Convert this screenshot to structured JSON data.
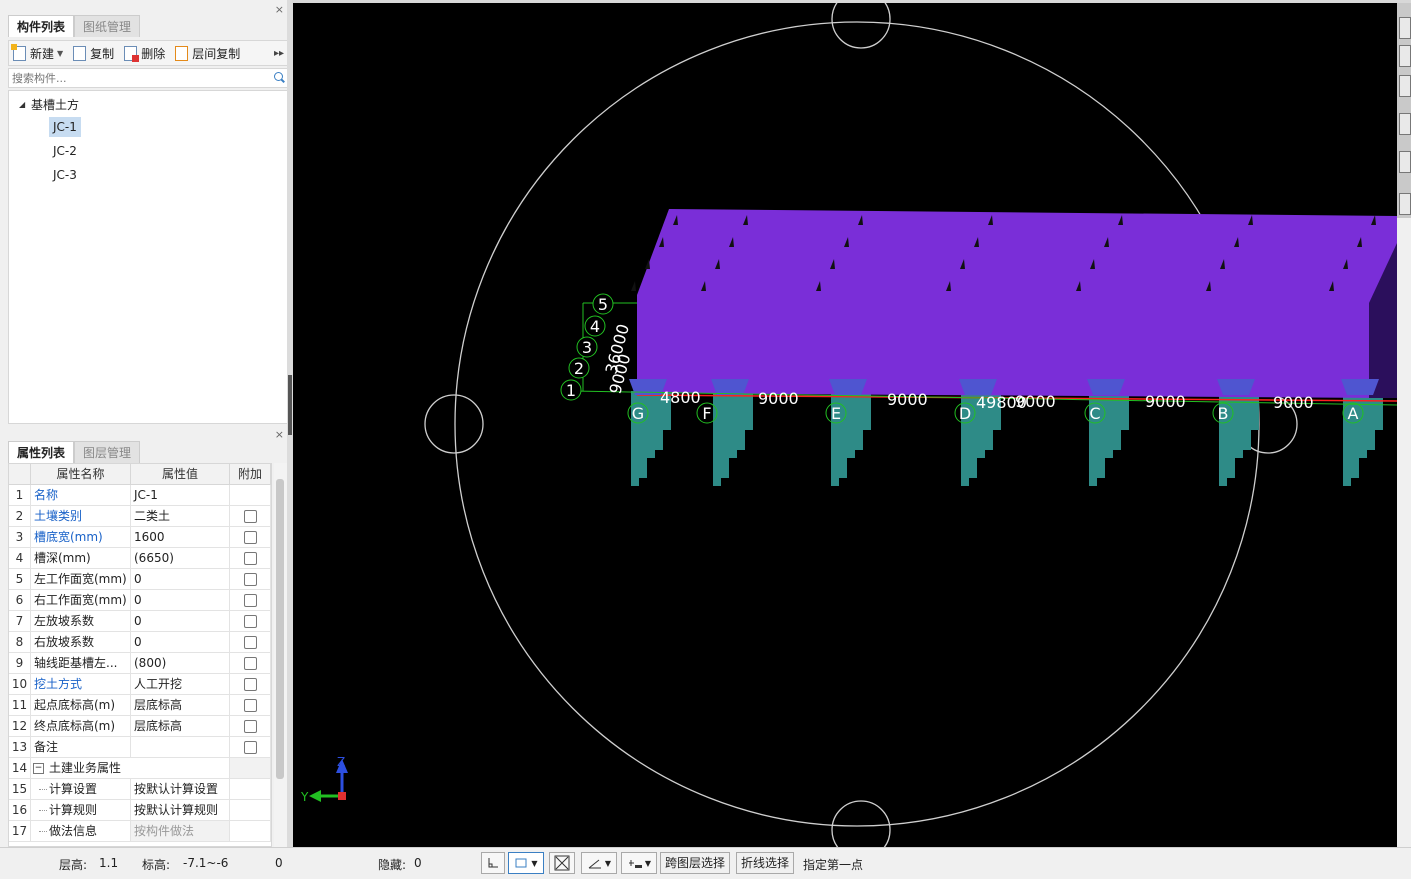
{
  "component_panel": {
    "tabs": [
      "构件列表",
      "图纸管理"
    ],
    "close": "×",
    "toolbar": {
      "new": "新建",
      "copy": "复制",
      "delete": "删除",
      "floor_copy": "层间复制",
      "more": "▸▸"
    },
    "search_placeholder": "搜索构件...",
    "tree": {
      "root": "基槽土方",
      "items": [
        "JC-1",
        "JC-2",
        "JC-3"
      ],
      "selected": "JC-1"
    }
  },
  "property_panel": {
    "tabs": [
      "属性列表",
      "图层管理"
    ],
    "close": "×",
    "headers": {
      "no": "",
      "name": "属性名称",
      "value": "属性值",
      "add": "附加"
    },
    "rows": [
      {
        "no": "1",
        "name": "名称",
        "value": "JC-1",
        "blue": true,
        "checkbox": false
      },
      {
        "no": "2",
        "name": "土壤类别",
        "value": "二类土",
        "blue": true,
        "checkbox": true
      },
      {
        "no": "3",
        "name": "槽底宽(mm)",
        "value": "1600",
        "blue": true,
        "checkbox": true
      },
      {
        "no": "4",
        "name": "槽深(mm)",
        "value": "(6650)",
        "blue": false,
        "checkbox": true
      },
      {
        "no": "5",
        "name": "左工作面宽(mm)",
        "value": "0",
        "blue": false,
        "checkbox": true
      },
      {
        "no": "6",
        "name": "右工作面宽(mm)",
        "value": "0",
        "blue": false,
        "checkbox": true
      },
      {
        "no": "7",
        "name": "左放坡系数",
        "value": "0",
        "blue": false,
        "checkbox": true
      },
      {
        "no": "8",
        "name": "右放坡系数",
        "value": "0",
        "blue": false,
        "checkbox": true
      },
      {
        "no": "9",
        "name": "轴线距基槽左...",
        "value": "(800)",
        "blue": false,
        "checkbox": true
      },
      {
        "no": "10",
        "name": "挖土方式",
        "value": "人工开挖",
        "blue": true,
        "checkbox": true
      },
      {
        "no": "11",
        "name": "起点底标高(m)",
        "value": "层底标高",
        "blue": false,
        "checkbox": true
      },
      {
        "no": "12",
        "name": "终点底标高(m)",
        "value": "层底标高",
        "blue": false,
        "checkbox": true
      },
      {
        "no": "13",
        "name": "备注",
        "value": "",
        "blue": false,
        "checkbox": true
      }
    ],
    "group": {
      "no": "14",
      "toggle": "−",
      "name": "土建业务属性"
    },
    "sub_rows": [
      {
        "no": "15",
        "name": "计算设置",
        "value": "按默认计算设置",
        "gray": false
      },
      {
        "no": "16",
        "name": "计算规则",
        "value": "按默认计算规则",
        "gray": false
      },
      {
        "no": "17",
        "name": "做法信息",
        "value": "按构件做法",
        "gray": true
      }
    ]
  },
  "viewport": {
    "axis_labels": {
      "z": "Z",
      "y": "Y"
    },
    "grid_letters": [
      "G",
      "F",
      "E",
      "D",
      "C",
      "B",
      "A"
    ],
    "grid_numbers": [
      "1",
      "2",
      "3",
      "4",
      "5"
    ],
    "dimensions": [
      "4800",
      "9000",
      "9000",
      "49800",
      "9000",
      "9000",
      "9000"
    ],
    "side_dims": [
      "36000",
      "9000"
    ],
    "colors": {
      "slab": "#7a2ed8",
      "piles": "#2e8b87",
      "caps": "#4f55d0",
      "grid": "#22c022",
      "circle": "#cfcfcf"
    }
  },
  "status": {
    "floor_height_label": "层高:",
    "floor_height_value": "1.1",
    "elevation_label": "标高:",
    "elevation_value": "-7.1~-6",
    "zero": "0",
    "hidden_label": "隐藏:",
    "hidden_value": "0",
    "cross_layer": "跨图层选择",
    "polyline": "折线选择",
    "prompt": "指定第一点"
  }
}
